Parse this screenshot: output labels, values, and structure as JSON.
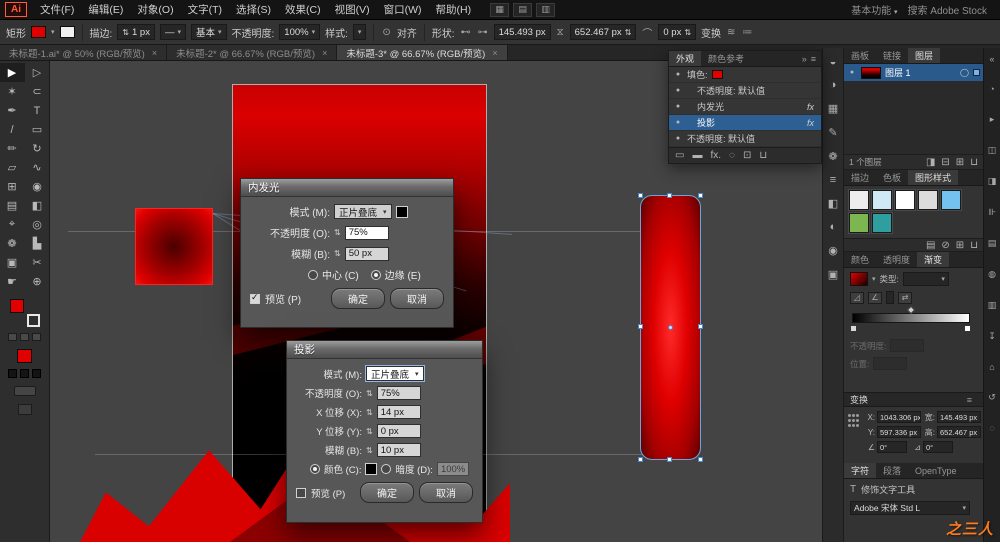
{
  "app": {
    "logo": "Ai"
  },
  "menubar": {
    "items": [
      "文件(F)",
      "编辑(E)",
      "对象(O)",
      "文字(T)",
      "选择(S)",
      "效果(C)",
      "视图(V)",
      "窗口(W)",
      "帮助(H)"
    ],
    "doc_icons": [
      {
        "name": "arrange-documents-icon",
        "glyph": "▦"
      },
      {
        "name": "document-grid-icon",
        "glyph": "▤"
      },
      {
        "name": "screen-mode-icon",
        "glyph": "▥"
      }
    ],
    "workspace_label": "基本功能",
    "search_label": "搜索 Adobe Stock"
  },
  "controlbar": {
    "tool_label": "矩形",
    "stroke_label": "描边:",
    "stroke_value": "1 px",
    "profile_glyph": "—",
    "brush_value": "基本",
    "opacity_label": "不透明度:",
    "opacity_value": "100%",
    "style_label": "样式:",
    "align_label": "对齐",
    "shape_label": "形状:",
    "w_value": "145.493 px",
    "h_value": "652.467 px",
    "corner_value": "0 px",
    "transform_label": "变换"
  },
  "tabs": [
    {
      "label": "未标题-1.ai* @ 50% (RGB/预览)",
      "active": false
    },
    {
      "label": "未标题-2* @ 66.67% (RGB/预览)",
      "active": false
    },
    {
      "label": "未标题-3* @ 66.67% (RGB/预览)",
      "active": true
    }
  ],
  "tools": [
    {
      "name": "selection-tool",
      "glyph": "▶",
      "active": true
    },
    {
      "name": "direct-selection-tool",
      "glyph": "▷",
      "active": false
    },
    {
      "name": "magic-wand-tool",
      "glyph": "✶",
      "active": false
    },
    {
      "name": "lasso-tool",
      "glyph": "⊂",
      "active": false
    },
    {
      "name": "pen-tool",
      "glyph": "✒",
      "active": false
    },
    {
      "name": "type-tool",
      "glyph": "T",
      "active": false
    },
    {
      "name": "line-segment-tool",
      "glyph": "/",
      "active": false
    },
    {
      "name": "rectangle-tool",
      "glyph": "▭",
      "active": false
    },
    {
      "name": "pencil-tool",
      "glyph": "✏",
      "active": false
    },
    {
      "name": "rotate-tool",
      "glyph": "↻",
      "active": false
    },
    {
      "name": "scale-tool",
      "glyph": "▱",
      "active": false
    },
    {
      "name": "width-tool",
      "glyph": "∿",
      "active": false
    },
    {
      "name": "free-transform-tool",
      "glyph": "⊞",
      "active": false
    },
    {
      "name": "shape-builder-tool",
      "glyph": "◉",
      "active": false
    },
    {
      "name": "mesh-tool",
      "glyph": "▤",
      "active": false
    },
    {
      "name": "gradient-tool",
      "glyph": "◧",
      "active": false
    },
    {
      "name": "eyedropper-tool",
      "glyph": "⌖",
      "active": false
    },
    {
      "name": "blend-tool",
      "glyph": "◎",
      "active": false
    },
    {
      "name": "symbol-sprayer-tool",
      "glyph": "❁",
      "active": false
    },
    {
      "name": "column-graph-tool",
      "glyph": "▙",
      "active": false
    },
    {
      "name": "artboard-tool",
      "glyph": "▣",
      "active": false
    },
    {
      "name": "slice-tool",
      "glyph": "✂",
      "active": false
    },
    {
      "name": "hand-tool",
      "glyph": "☛",
      "active": false
    },
    {
      "name": "zoom-tool",
      "glyph": "⊕",
      "active": false
    }
  ],
  "dialogs": {
    "inner_glow": {
      "title": "内发光",
      "mode_label": "模式 (M):",
      "mode_value": "正片叠底",
      "opacity_label": "不透明度 (O):",
      "opacity_value": "75%",
      "blur_label": "模糊 (B):",
      "blur_value": "50 px",
      "center_label": "中心 (C)",
      "edge_label": "边缘 (E)",
      "preview_label": "预览 (P)",
      "ok_label": "确定",
      "cancel_label": "取消"
    },
    "drop_shadow": {
      "title": "投影",
      "mode_label": "模式 (M):",
      "mode_value": "正片叠底",
      "opacity_label": "不透明度 (O):",
      "opacity_value": "75%",
      "x_label": "X 位移 (X):",
      "x_value": "14 px",
      "y_label": "Y 位移 (Y):",
      "y_value": "0 px",
      "blur_label": "模糊 (B):",
      "blur_value": "10 px",
      "color_label": "颜色 (C):",
      "darkness_label": "暗度 (D):",
      "darkness_value": "100%",
      "preview_label": "预览 (P)",
      "ok_label": "确定",
      "cancel_label": "取消"
    }
  },
  "appearance": {
    "tab_appearance": "外观",
    "tab_color_guide": "颜色参考",
    "rows": [
      {
        "label": "填色:",
        "swatch": "#e00000",
        "fx": "",
        "selected": false,
        "indent": 0
      },
      {
        "label": "不透明度: 默认值",
        "swatch": "",
        "fx": "",
        "selected": false,
        "indent": 1
      },
      {
        "label": "内发光",
        "swatch": "",
        "fx": "fx",
        "selected": false,
        "indent": 1
      },
      {
        "label": "投影",
        "swatch": "",
        "fx": "fx",
        "selected": true,
        "indent": 1
      },
      {
        "label": "不透明度: 默认值",
        "swatch": "",
        "fx": "",
        "selected": false,
        "indent": 0
      }
    ],
    "footer_icons": [
      {
        "name": "add-stroke-icon",
        "glyph": "▭"
      },
      {
        "name": "add-fill-icon",
        "glyph": "▬"
      },
      {
        "name": "add-effect-icon",
        "glyph": "fx."
      },
      {
        "name": "clear-appearance-icon",
        "glyph": "◌"
      },
      {
        "name": "duplicate-item-icon",
        "glyph": "⊡"
      },
      {
        "name": "delete-item-icon",
        "glyph": "⊔"
      }
    ]
  },
  "layers": {
    "tabs": [
      "画板",
      "链接",
      "图层"
    ],
    "active_tab": "图层",
    "layer_name": "图层 1",
    "count_text": "1 个图层",
    "footer_icons": [
      {
        "name": "make-clipping-mask-icon",
        "glyph": "◨"
      },
      {
        "name": "new-sublayer-icon",
        "glyph": "⊟"
      },
      {
        "name": "new-layer-icon",
        "glyph": "⊞"
      },
      {
        "name": "delete-layer-icon",
        "glyph": "⊔"
      }
    ]
  },
  "styles_panel": {
    "tabs": [
      "描边",
      "色板",
      "图形样式"
    ],
    "active_tab": "图形样式",
    "thumbs": [
      "#ededed",
      "#cfe9f7",
      "#ffffff",
      "#dcdcdc",
      "#74c2ef",
      "#7cb651",
      "#2f9e9e"
    ],
    "footer_icons": [
      {
        "name": "style-libraries-icon",
        "glyph": "▤"
      },
      {
        "name": "break-link-style-icon",
        "glyph": "⊘"
      },
      {
        "name": "new-style-icon",
        "glyph": "⊞"
      },
      {
        "name": "delete-style-icon",
        "glyph": "⊔"
      }
    ]
  },
  "gradient_panel": {
    "tabs": [
      "颜色",
      "透明度",
      "渐变"
    ],
    "active_tab": "渐变",
    "type_label": "类型:",
    "opacity_label": "不透明度:",
    "location_label": "位置:",
    "swatch_from": "#e00000",
    "swatch_to": "#1a0000",
    "bar_from": "#000000",
    "bar_to": "#ffffff"
  },
  "transform_panel": {
    "title": "变换",
    "x_label": "X:",
    "x_value": "1043.306 px",
    "y_label": "Y:",
    "y_value": "597.336 px",
    "w_label": "宽:",
    "w_value": "145.493 px",
    "h_label": "高:",
    "h_value": "652.467 px",
    "rotate_value": "0°",
    "shear_value": "0°"
  },
  "character_panel": {
    "tabs": [
      "字符",
      "段落",
      "OpenType"
    ],
    "active_tab": "字符",
    "touch_type_label": "修饰文字工具",
    "font_value": "Adobe 宋体 Std L"
  },
  "dock_icons": [
    {
      "name": "color-panel-icon",
      "glyph": "◒"
    },
    {
      "name": "color-guide-panel-icon",
      "glyph": "◑"
    },
    {
      "name": "swatches-panel-icon",
      "glyph": "▦"
    },
    {
      "name": "brushes-panel-icon",
      "glyph": "✎"
    },
    {
      "name": "symbols-panel-icon",
      "glyph": "❁"
    },
    {
      "name": "stroke-panel-icon",
      "glyph": "≡"
    },
    {
      "name": "gradient-panel-icon",
      "glyph": "◧"
    },
    {
      "name": "transparency-panel-icon",
      "glyph": "◐"
    },
    {
      "name": "appearance-panel-icon",
      "glyph": "◉"
    },
    {
      "name": "graphic-styles-panel-icon",
      "glyph": "▣"
    }
  ],
  "far_icons": [
    {
      "name": "collapse-panels-icon",
      "glyph": "«"
    },
    {
      "name": "info-panel-icon",
      "glyph": "◔"
    },
    {
      "name": "actions-panel-icon",
      "glyph": "▸"
    },
    {
      "name": "navigator-panel-icon",
      "glyph": "◫"
    },
    {
      "name": "pathfinder-panel-icon",
      "glyph": "◨"
    },
    {
      "name": "align-panel-icon",
      "glyph": "⊪"
    },
    {
      "name": "document-info-panel-icon",
      "glyph": "▤"
    },
    {
      "name": "separations-panel-icon",
      "glyph": "◍"
    },
    {
      "name": "layers-panel-icon",
      "glyph": "▥"
    },
    {
      "name": "asset-export-panel-icon",
      "glyph": "↧"
    },
    {
      "name": "libraries-panel-icon",
      "glyph": "⌂"
    },
    {
      "name": "history-panel-icon",
      "glyph": "↺"
    },
    {
      "name": "comments-panel-icon",
      "glyph": "◌"
    }
  ],
  "watermark": "之三人"
}
